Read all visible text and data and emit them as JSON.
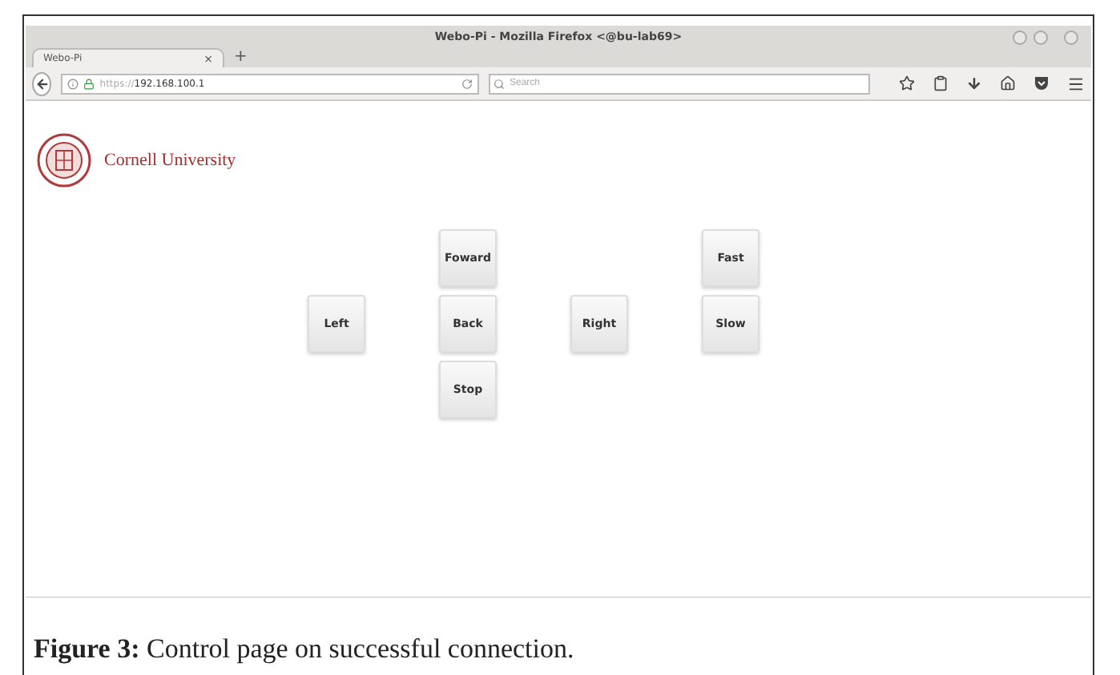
{
  "window": {
    "title": "Webo-Pi - Mozilla Firefox <@bu-lab69>"
  },
  "tabs": [
    {
      "label": "Webo-Pi",
      "selected": true,
      "close": "×"
    }
  ],
  "new_tab": "+",
  "address_bar": {
    "scheme": "https://",
    "host": "192.168.100.1"
  },
  "search": {
    "placeholder": "Search"
  },
  "page": {
    "logo_text": "Cornell University",
    "buttons": [
      {
        "label": "Foward"
      },
      {
        "label": "Fast"
      },
      {
        "label": "Left"
      },
      {
        "label": "Back"
      },
      {
        "label": "Right"
      },
      {
        "label": "Slow"
      },
      {
        "label": "Stop"
      }
    ]
  },
  "caption": {
    "label": "Figure 3:",
    "text": "Control page on successful connection."
  }
}
